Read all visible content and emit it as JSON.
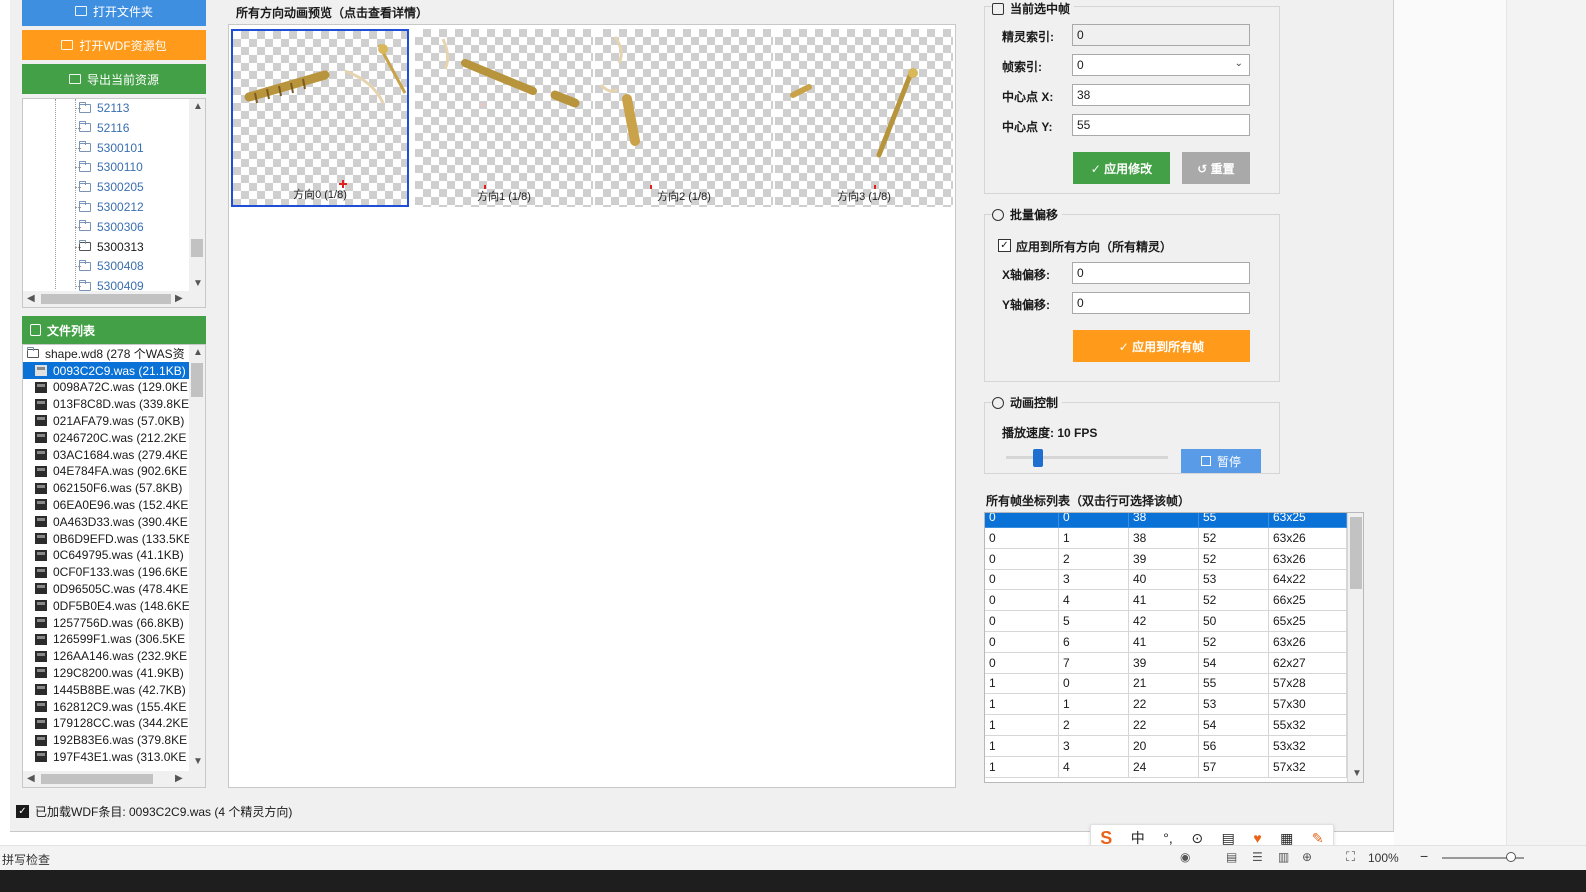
{
  "left": {
    "btn_open_folder": "打开文件夹",
    "btn_open_wdf": "打开WDF资源包",
    "btn_export": "导出当前资源",
    "tree_items": [
      "52113",
      "52116",
      "5300101",
      "5300110",
      "5300205",
      "5300212",
      "5300306",
      "5300313",
      "5300408",
      "5300409"
    ],
    "tree_selected": "5300313",
    "file_list_title": "文件列表",
    "file_root": "shape.wd8 (278 个WAS资",
    "files": [
      "0093C2C9.was (21.1KB)",
      "0098A72C.was (129.0KE",
      "013F8C8D.was (339.8KE",
      "021AFA79.was (57.0KB)",
      "0246720C.was (212.2KE",
      "03AC1684.was (279.4KE",
      "04E784FA.was (902.6KE",
      "062150F6.was (57.8KB)",
      "06EA0E96.was (152.4KE",
      "0A463D33.was (390.4KE",
      "0B6D9EFD.was (133.5KE",
      "0C649795.was (41.1KB)",
      "0CF0F133.was (196.6KE",
      "0D96505C.was (478.4KE",
      "0DF5B0E4.was (148.6KE",
      "1257756D.was (66.8KB)",
      "126599F1.was (306.5KE",
      "126AA146.was (232.9KE",
      "129C8200.was (41.9KB)",
      "1445B8BE.was (42.7KB)",
      "162812C9.was (155.4KE",
      "179128CC.was (344.2KE",
      "192B83E6.was (379.8KE",
      "197F43E1.was (313.0KE"
    ]
  },
  "preview": {
    "title": "所有方向动画预览（点击查看详情）",
    "tiles": [
      "方向0 (1/8)",
      "方向1 (1/8)",
      "方向2 (1/8)",
      "方向3 (1/8)"
    ]
  },
  "current_frame": {
    "title": "当前选中帧",
    "sprite_index_label": "精灵索引:",
    "sprite_index_value": "0",
    "frame_index_label": "帧索引:",
    "frame_index_value": "0",
    "center_x_label": "中心点 X:",
    "center_x_value": "38",
    "center_y_label": "中心点 Y:",
    "center_y_value": "55",
    "apply_label": "✓ 应用修改",
    "reset_label": "↺ 重置"
  },
  "batch": {
    "title": "批量偏移",
    "apply_all_dirs_label": "应用到所有方向（所有精灵）",
    "x_offset_label": "X轴偏移:",
    "x_offset_value": "0",
    "y_offset_label": "Y轴偏移:",
    "y_offset_value": "0",
    "apply_all_frames_label": "✓ 应用到所有帧"
  },
  "anim": {
    "title": "动画控制",
    "speed_label": "播放速度: 10 FPS",
    "pause_label": "暂停",
    "speed_fraction": 0.2
  },
  "frames_table": {
    "title": "所有帧坐标列表（双击行可选择该帧）",
    "rows": [
      [
        "0",
        "0",
        "38",
        "55",
        "63x25"
      ],
      [
        "0",
        "1",
        "38",
        "52",
        "63x26"
      ],
      [
        "0",
        "2",
        "39",
        "52",
        "63x26"
      ],
      [
        "0",
        "3",
        "40",
        "53",
        "64x22"
      ],
      [
        "0",
        "4",
        "41",
        "52",
        "66x25"
      ],
      [
        "0",
        "5",
        "42",
        "50",
        "65x25"
      ],
      [
        "0",
        "6",
        "41",
        "52",
        "63x26"
      ],
      [
        "0",
        "7",
        "39",
        "54",
        "62x27"
      ],
      [
        "1",
        "0",
        "21",
        "55",
        "57x28"
      ],
      [
        "1",
        "1",
        "22",
        "53",
        "57x30"
      ],
      [
        "1",
        "2",
        "22",
        "54",
        "55x32"
      ],
      [
        "1",
        "3",
        "20",
        "56",
        "53x32"
      ],
      [
        "1",
        "4",
        "24",
        "57",
        "57x32"
      ]
    ]
  },
  "status": {
    "text": "已加载WDF条目: 0093C2C9.was (4 个精灵方向)"
  },
  "bottom": {
    "spell_check": "拼写检查",
    "zoom": "100%",
    "ime_lang": "中"
  },
  "colors": {
    "blue_btn": "#3f8fe0",
    "orange_btn": "#ff9a1a",
    "green_btn": "#43a047",
    "selection": "#0a72d6",
    "gray_btn": "#a9a9a9"
  }
}
